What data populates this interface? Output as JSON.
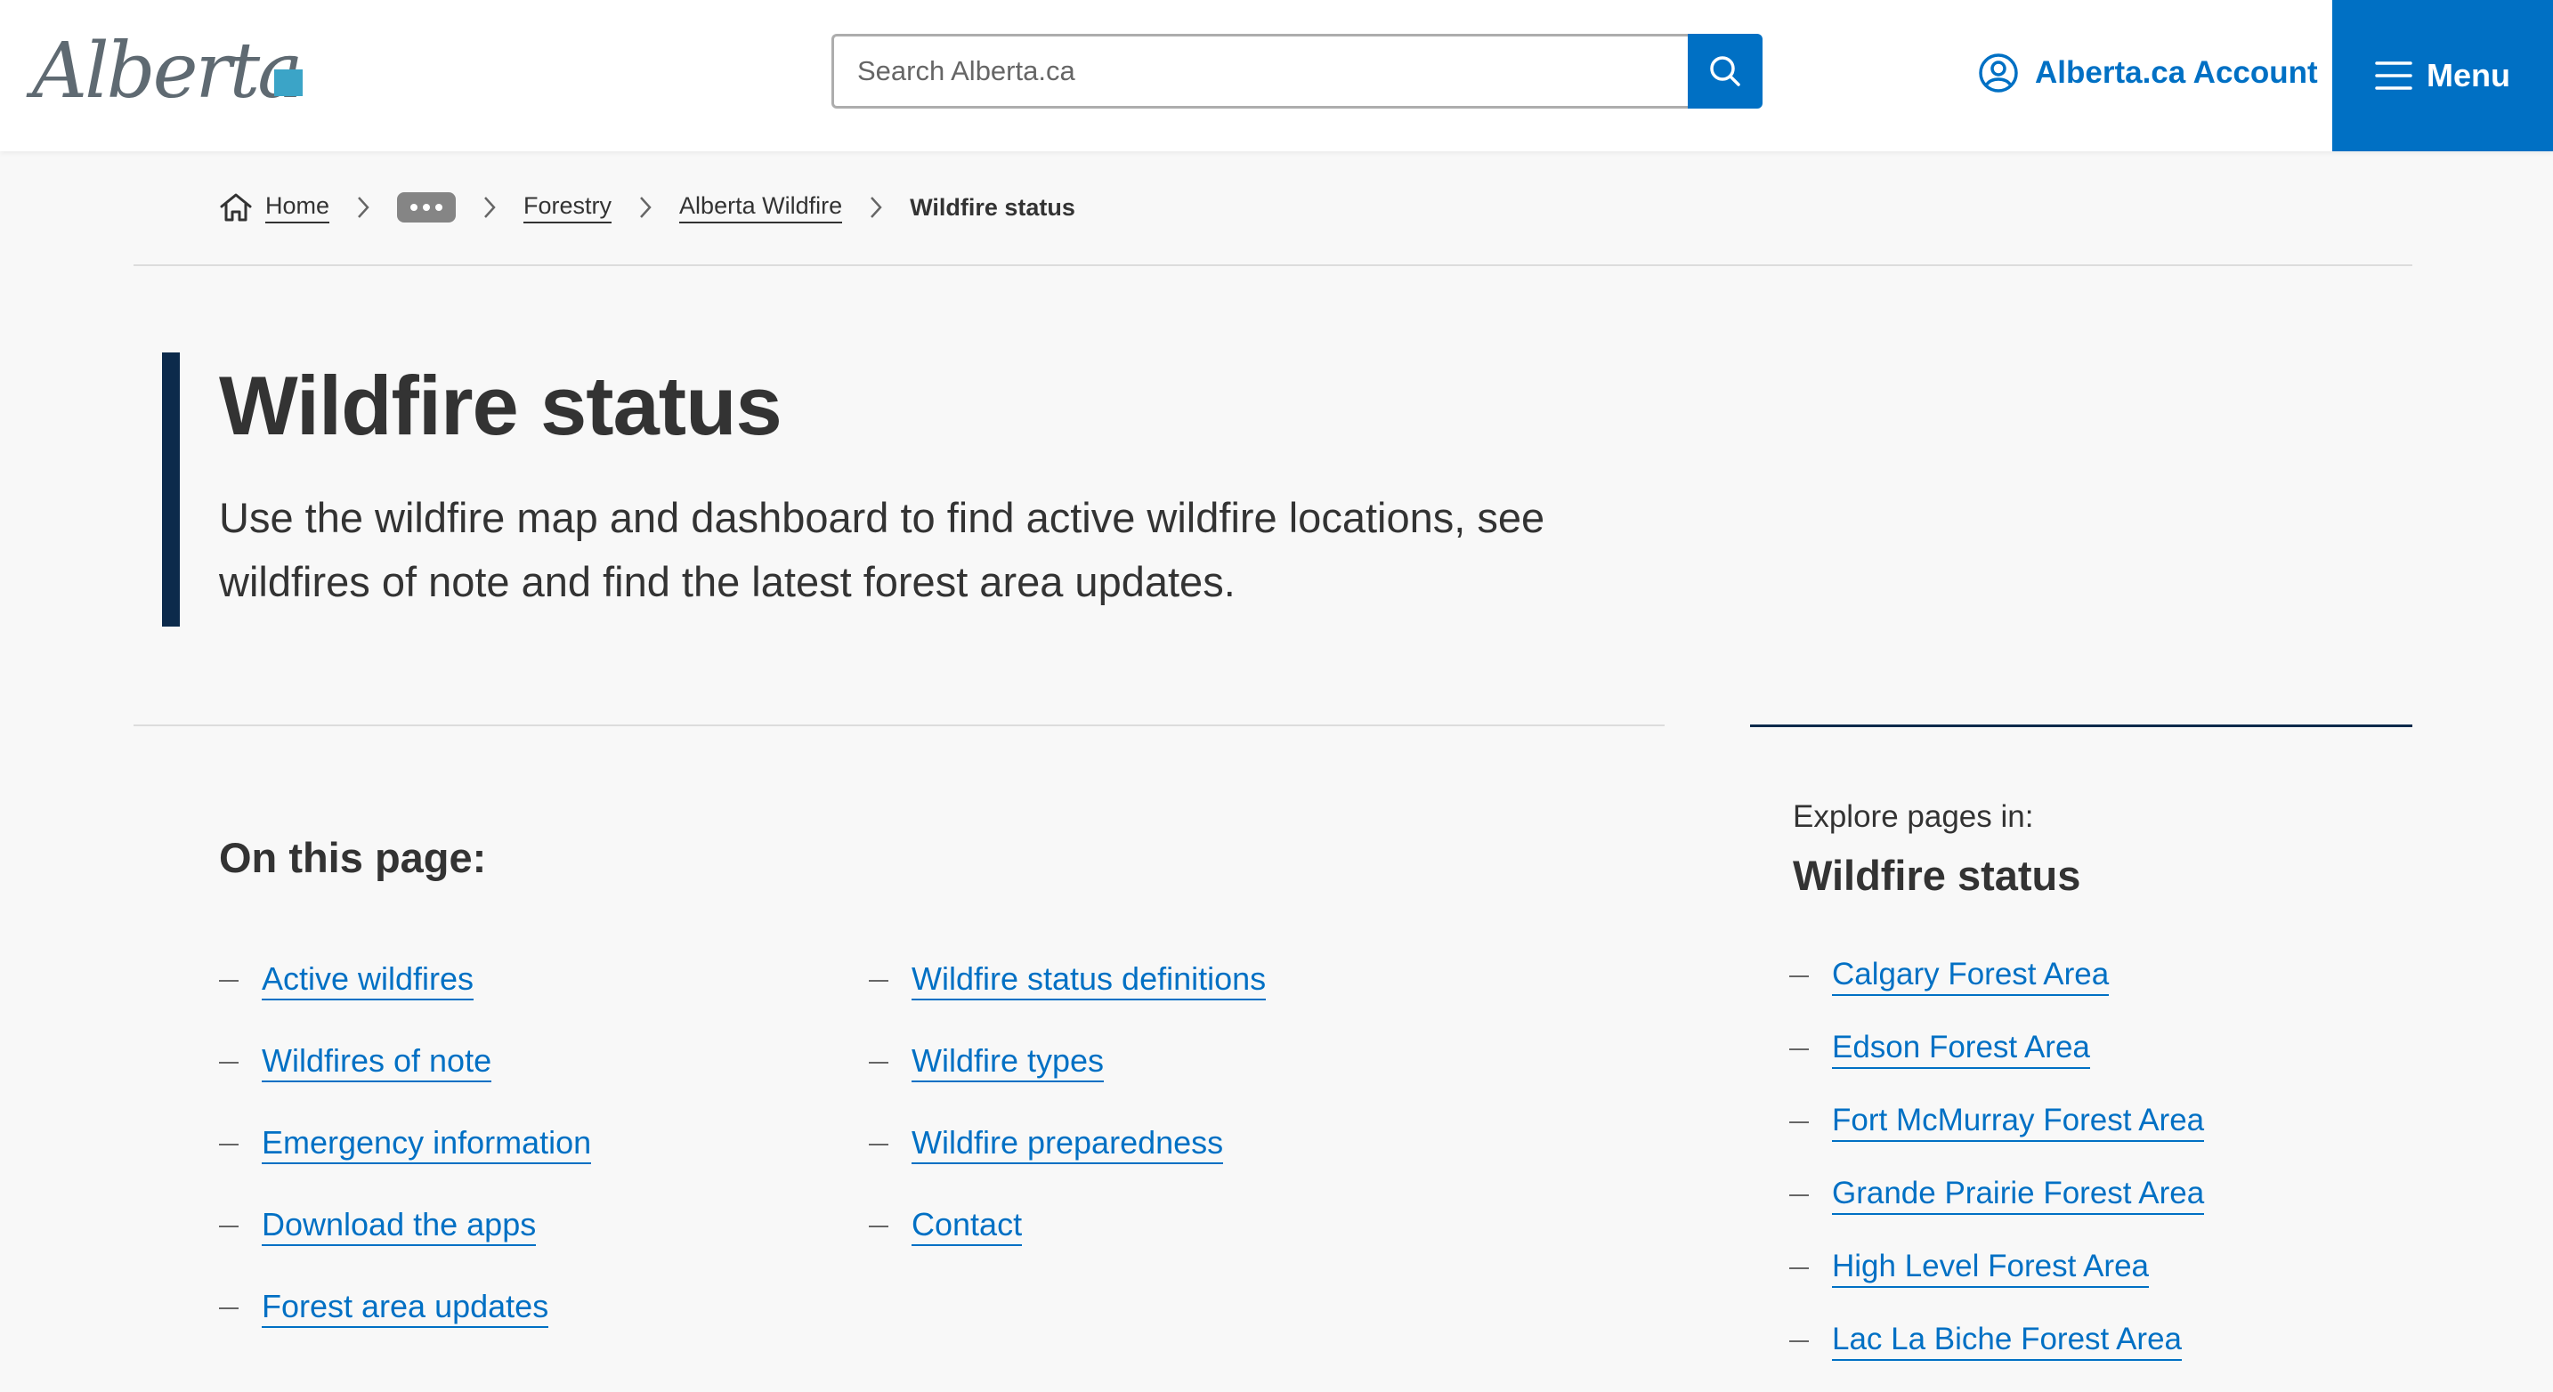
{
  "header": {
    "logo_text": "Alberta",
    "search_placeholder": "Search Alberta.ca",
    "account_label": "Alberta.ca Account",
    "menu_label": "Menu"
  },
  "breadcrumb": {
    "home": "Home",
    "items": [
      "Forestry",
      "Alberta Wildfire"
    ],
    "current": "Wildfire status"
  },
  "hero": {
    "title": "Wildfire status",
    "description": "Use the wildfire map and dashboard to find active wildfire locations, see wildfires of note and find the latest forest area updates."
  },
  "on_this_page": {
    "title": "On this page:",
    "col1": [
      "Active wildfires",
      "Wildfires of note",
      "Emergency information",
      "Download the apps",
      "Forest area updates"
    ],
    "col2": [
      "Wildfire status definitions",
      "Wildfire types",
      "Wildfire preparedness",
      "Contact"
    ]
  },
  "side": {
    "kicker": "Explore pages in:",
    "title": "Wildfire status",
    "links": [
      "Calgary Forest Area",
      "Edson Forest Area",
      "Fort McMurray Forest Area",
      "Grande Prairie Forest Area",
      "High Level Forest Area",
      "Lac La Biche Forest Area"
    ]
  },
  "colors": {
    "brand_blue": "#0070c4",
    "navy": "#0c2a4b",
    "logo_teal": "#3ba4c7"
  }
}
